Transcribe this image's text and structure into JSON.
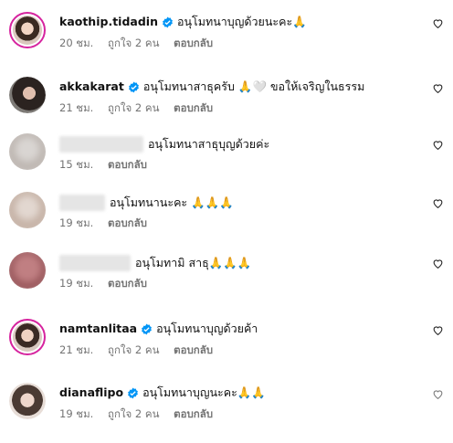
{
  "comments": [
    {
      "username": "kaothip.tidadin",
      "verified": true,
      "text": "อนุโมทนาบุญด้วยนะคะ🙏",
      "time": "20 ชม.",
      "likes": "ถูกใจ 2 คน",
      "reply": "ตอบกลับ",
      "avatar": "story",
      "blurred": false
    },
    {
      "username": "akkakarat",
      "verified": true,
      "text": "อนุโมทนาสาธุครับ 🙏🤍 ขอให้เจริญในธรรม",
      "time": "21 ชม.",
      "likes": "ถูกใจ 2 คน",
      "reply": "ตอบกลับ",
      "avatar": "plain",
      "blurred": false
    },
    {
      "username": "",
      "verified": false,
      "text": "อนุโมทนาสาธุบุญด้วยค่ะ",
      "time": "15 ชม.",
      "likes": "",
      "reply": "ตอบกลับ",
      "avatar": "plain",
      "blurred": true
    },
    {
      "username": "",
      "verified": false,
      "text": "อนุโมทนานะคะ 🙏🙏🙏",
      "time": "19 ชม.",
      "likes": "",
      "reply": "ตอบกลับ",
      "avatar": "plain",
      "blurred": true
    },
    {
      "username": "",
      "verified": false,
      "text": "อนุโมทามิ สาธุ🙏🙏🙏",
      "time": "19 ชม.",
      "likes": "",
      "reply": "ตอบกลับ",
      "avatar": "plain",
      "blurred": true
    },
    {
      "username": "namtanlitaa",
      "verified": true,
      "text": "อนุโมทนาบุญด้วยค้า",
      "time": "21 ชม.",
      "likes": "ถูกใจ 2 คน",
      "reply": "ตอบกลับ",
      "avatar": "story",
      "blurred": false
    },
    {
      "username": "dianaflipo",
      "verified": true,
      "text": "อนุโมทนาบุญนะคะ🙏🙏",
      "time": "19 ชม.",
      "likes": "ถูกใจ 2 คน",
      "reply": "ตอบกลับ",
      "avatar": "plain",
      "blurred": false
    }
  ],
  "icons": {
    "verified": "verified-badge-icon",
    "like": "heart-outline-icon"
  },
  "colors": {
    "verified": "#0095f6",
    "meta": "#737373",
    "story_ring": "#d6249f"
  }
}
